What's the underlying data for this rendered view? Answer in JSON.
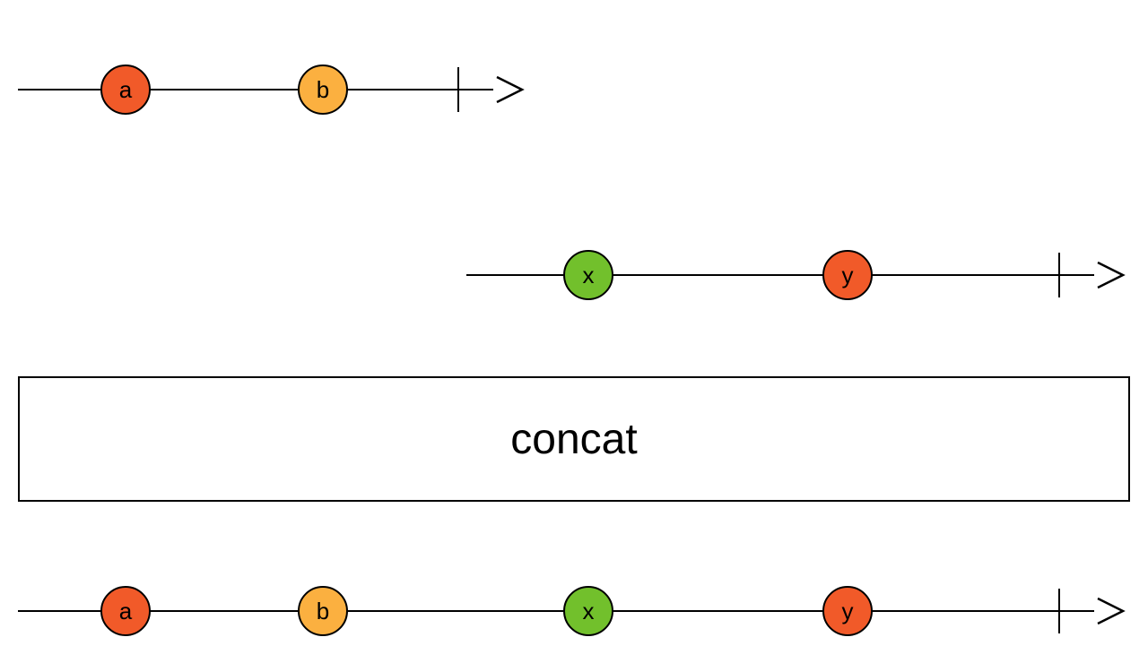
{
  "diagram": {
    "type": "rxjs-marble-diagram",
    "operator": "concat",
    "colors": {
      "orange": "#f15a29",
      "yellow": "#fbb040",
      "green": "#72c02c"
    },
    "source1": {
      "marbles": [
        {
          "label": "a",
          "color": "orange"
        },
        {
          "label": "b",
          "color": "yellow"
        }
      ]
    },
    "source2": {
      "marbles": [
        {
          "label": "x",
          "color": "green"
        },
        {
          "label": "y",
          "color": "orange"
        }
      ]
    },
    "output": {
      "marbles": [
        {
          "label": "a",
          "color": "orange"
        },
        {
          "label": "b",
          "color": "yellow"
        },
        {
          "label": "x",
          "color": "green"
        },
        {
          "label": "y",
          "color": "orange"
        }
      ]
    }
  }
}
